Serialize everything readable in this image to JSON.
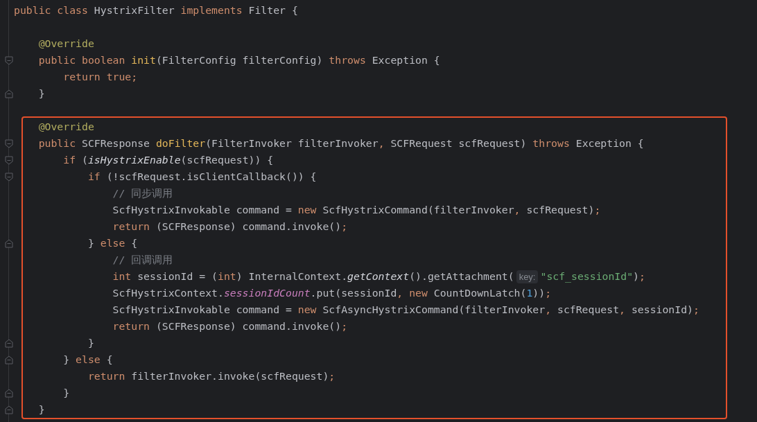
{
  "blocks": [
    {
      "boxed": false,
      "lines": [
        {
          "kind": "code",
          "tokens": [
            {
              "kind": "keyword",
              "text": "public class "
            },
            {
              "kind": "plain",
              "text": "HystrixFilter "
            },
            {
              "kind": "keyword",
              "text": "implements "
            },
            {
              "kind": "plain",
              "text": "Filter {"
            }
          ]
        },
        {
          "kind": "blank"
        },
        {
          "kind": "code",
          "tokens": [
            {
              "kind": "annotation",
              "text": "    @Override"
            }
          ]
        },
        {
          "kind": "code",
          "fold_start": true,
          "tokens": [
            {
              "kind": "keyword",
              "text": "    public boolean "
            },
            {
              "kind": "method",
              "text": "init"
            },
            {
              "kind": "plain",
              "text": "(FilterConfig filterConfig) "
            },
            {
              "kind": "keyword",
              "text": "throws "
            },
            {
              "kind": "plain",
              "text": "Exception {"
            }
          ]
        },
        {
          "kind": "code",
          "tokens": [
            {
              "kind": "keyword",
              "text": "        return true;"
            }
          ]
        },
        {
          "kind": "code",
          "fold_end": true,
          "tokens": [
            {
              "kind": "plain",
              "text": "    }"
            }
          ]
        },
        {
          "kind": "blank"
        }
      ]
    },
    {
      "boxed": true,
      "lines": [
        {
          "kind": "code",
          "tokens": [
            {
              "kind": "annotation",
              "text": "    @Override"
            }
          ]
        },
        {
          "kind": "code",
          "fold_start": true,
          "tokens": [
            {
              "kind": "keyword",
              "text": "    public "
            },
            {
              "kind": "plain",
              "text": "SCFResponse "
            },
            {
              "kind": "method",
              "text": "doFilter"
            },
            {
              "kind": "plain",
              "text": "(FilterInvoker filterInvoker"
            },
            {
              "kind": "keyword",
              "text": ", "
            },
            {
              "kind": "plain",
              "text": "SCFRequest scfRequest) "
            },
            {
              "kind": "keyword",
              "text": "throws "
            },
            {
              "kind": "plain",
              "text": "Exception {"
            }
          ]
        },
        {
          "kind": "code",
          "fold_start": true,
          "tokens": [
            {
              "kind": "keyword",
              "text": "        if "
            },
            {
              "kind": "plain",
              "text": "("
            },
            {
              "kind": "static_method",
              "text": "isHystrixEnable"
            },
            {
              "kind": "plain",
              "text": "(scfRequest)) {"
            }
          ]
        },
        {
          "kind": "code",
          "fold_start": true,
          "tokens": [
            {
              "kind": "keyword",
              "text": "            if "
            },
            {
              "kind": "plain",
              "text": "(!scfRequest.isClientCallback()) {"
            }
          ]
        },
        {
          "kind": "code",
          "tokens": [
            {
              "kind": "comment",
              "text": "                // 同步调用"
            }
          ]
        },
        {
          "kind": "code",
          "tokens": [
            {
              "kind": "plain",
              "text": "                ScfHystrixInvokable command = "
            },
            {
              "kind": "keyword",
              "text": "new "
            },
            {
              "kind": "plain",
              "text": "ScfHystrixCommand(filterInvoker"
            },
            {
              "kind": "keyword",
              "text": ", "
            },
            {
              "kind": "plain",
              "text": "scfRequest)"
            },
            {
              "kind": "keyword",
              "text": ";"
            }
          ]
        },
        {
          "kind": "code",
          "tokens": [
            {
              "kind": "keyword",
              "text": "                return "
            },
            {
              "kind": "plain",
              "text": "(SCFResponse) command.invoke()"
            },
            {
              "kind": "keyword",
              "text": ";"
            }
          ]
        },
        {
          "kind": "code",
          "fold_end": true,
          "tokens": [
            {
              "kind": "plain",
              "text": "            } "
            },
            {
              "kind": "keyword",
              "text": "else "
            },
            {
              "kind": "plain",
              "text": "{"
            }
          ]
        },
        {
          "kind": "code",
          "tokens": [
            {
              "kind": "comment",
              "text": "                // 回调调用"
            }
          ]
        },
        {
          "kind": "code",
          "tokens": [
            {
              "kind": "keyword",
              "text": "                int "
            },
            {
              "kind": "plain",
              "text": "sessionId = ("
            },
            {
              "kind": "keyword",
              "text": "int"
            },
            {
              "kind": "plain",
              "text": ") InternalContext."
            },
            {
              "kind": "static_method",
              "text": "getContext"
            },
            {
              "kind": "plain",
              "text": "().getAttachment("
            },
            {
              "kind": "hint",
              "text": "key:"
            },
            {
              "kind": "string",
              "text": "\"scf_sessionId\""
            },
            {
              "kind": "plain",
              "text": ")"
            },
            {
              "kind": "keyword",
              "text": ";"
            }
          ]
        },
        {
          "kind": "code",
          "tokens": [
            {
              "kind": "plain",
              "text": "                ScfHystrixContext."
            },
            {
              "kind": "static_field",
              "text": "sessionIdCount"
            },
            {
              "kind": "plain",
              "text": ".put(sessionId"
            },
            {
              "kind": "keyword",
              "text": ", new "
            },
            {
              "kind": "plain",
              "text": "CountDownLatch("
            },
            {
              "kind": "number",
              "text": "1"
            },
            {
              "kind": "plain",
              "text": "))"
            },
            {
              "kind": "keyword",
              "text": ";"
            }
          ]
        },
        {
          "kind": "code",
          "tokens": [
            {
              "kind": "plain",
              "text": "                ScfHystrixInvokable command = "
            },
            {
              "kind": "keyword",
              "text": "new "
            },
            {
              "kind": "plain",
              "text": "ScfAsyncHystrixCommand(filterInvoker"
            },
            {
              "kind": "keyword",
              "text": ", "
            },
            {
              "kind": "plain",
              "text": "scfRequest"
            },
            {
              "kind": "keyword",
              "text": ", "
            },
            {
              "kind": "plain",
              "text": "sessionId)"
            },
            {
              "kind": "keyword",
              "text": ";"
            }
          ]
        },
        {
          "kind": "code",
          "tokens": [
            {
              "kind": "keyword",
              "text": "                return "
            },
            {
              "kind": "plain",
              "text": "(SCFResponse) command.invoke()"
            },
            {
              "kind": "keyword",
              "text": ";"
            }
          ]
        },
        {
          "kind": "code",
          "fold_end": true,
          "tokens": [
            {
              "kind": "plain",
              "text": "            }"
            }
          ]
        },
        {
          "kind": "code",
          "fold_end": true,
          "tokens": [
            {
              "kind": "plain",
              "text": "        } "
            },
            {
              "kind": "keyword",
              "text": "else "
            },
            {
              "kind": "plain",
              "text": "{"
            }
          ]
        },
        {
          "kind": "code",
          "tokens": [
            {
              "kind": "keyword",
              "text": "            return "
            },
            {
              "kind": "plain",
              "text": "filterInvoker.invoke(scfRequest)"
            },
            {
              "kind": "keyword",
              "text": ";"
            }
          ]
        },
        {
          "kind": "code",
          "fold_end": true,
          "tokens": [
            {
              "kind": "plain",
              "text": "        }"
            }
          ]
        },
        {
          "kind": "code",
          "fold_end": true,
          "tokens": [
            {
              "kind": "plain",
              "text": "    }"
            }
          ]
        }
      ]
    }
  ]
}
